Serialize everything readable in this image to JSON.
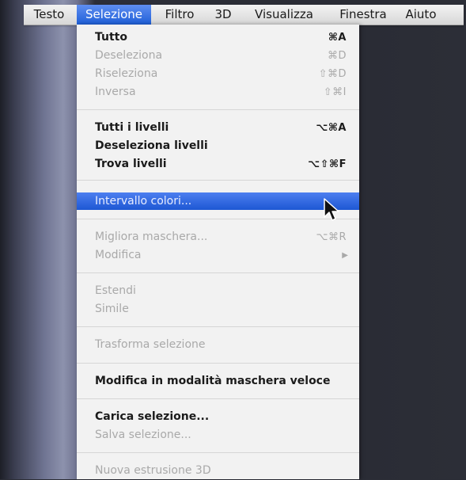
{
  "menubar": {
    "items": [
      {
        "label": "Testo",
        "active": false
      },
      {
        "label": "Selezione",
        "active": true
      },
      {
        "label": "Filtro",
        "active": false
      },
      {
        "label": "3D",
        "active": false
      },
      {
        "label": "Visualizza",
        "active": false
      },
      {
        "label": "Finestra",
        "active": false
      },
      {
        "label": "Aiuto",
        "active": false
      }
    ]
  },
  "menu": {
    "items": [
      {
        "label": "Tutto",
        "shortcut": "⌘A",
        "enabled": true
      },
      {
        "label": "Deseleziona",
        "shortcut": "⌘D",
        "enabled": false
      },
      {
        "label": "Riseleziona",
        "shortcut": "⇧⌘D",
        "enabled": false
      },
      {
        "label": "Inversa",
        "shortcut": "⇧⌘I",
        "enabled": false
      },
      {
        "label": "Tutti i livelli",
        "shortcut": "⌥⌘A",
        "enabled": true
      },
      {
        "label": "Deseleziona livelli",
        "shortcut": "",
        "enabled": true
      },
      {
        "label": "Trova livelli",
        "shortcut": "⌥⇧⌘F",
        "enabled": true
      },
      {
        "label": "Intervallo colori...",
        "shortcut": "",
        "enabled": true,
        "highlighted": true
      },
      {
        "label": "Migliora maschera...",
        "shortcut": "⌥⌘R",
        "enabled": false
      },
      {
        "label": "Modifica",
        "submenu": true,
        "enabled": false
      },
      {
        "label": "Estendi",
        "shortcut": "",
        "enabled": false
      },
      {
        "label": "Simile",
        "shortcut": "",
        "enabled": false
      },
      {
        "label": "Trasforma selezione",
        "shortcut": "",
        "enabled": false
      },
      {
        "label": "Modifica in modalità maschera veloce",
        "shortcut": "",
        "enabled": true
      },
      {
        "label": "Carica selezione...",
        "shortcut": "",
        "enabled": true
      },
      {
        "label": "Salva selezione...",
        "shortcut": "",
        "enabled": false
      },
      {
        "label": "Nuova estrusione 3D",
        "shortcut": "",
        "enabled": false
      }
    ],
    "submenu_arrow_icon": "triangle-right-icon"
  },
  "colors": {
    "highlight": "#1d57d3",
    "menu_background": "#f2f2f2",
    "disabled_text": "#a9a9a9"
  }
}
